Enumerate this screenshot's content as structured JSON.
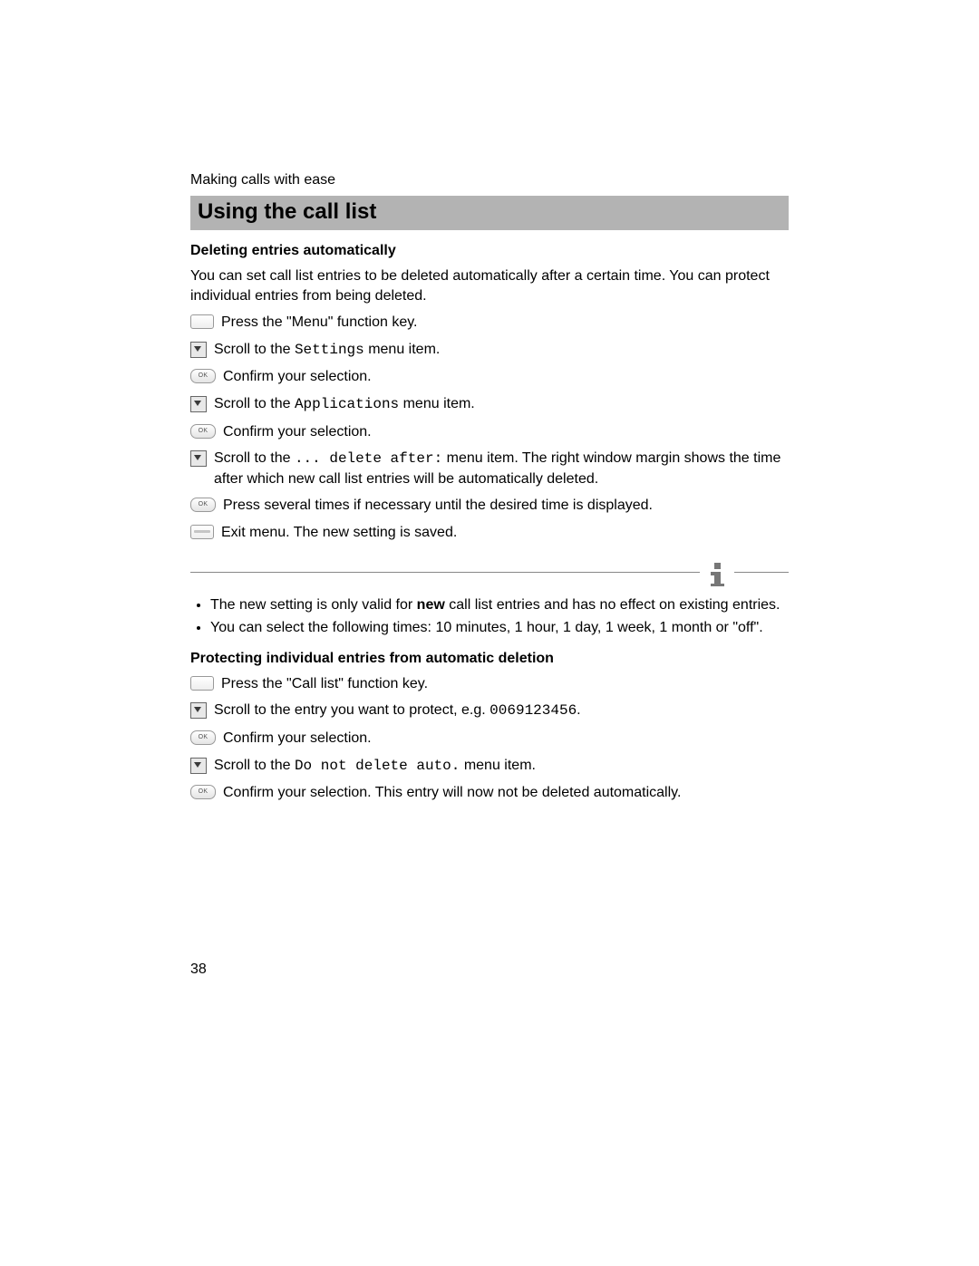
{
  "running_head": "Making calls with ease",
  "title": "Using the call list",
  "page_number": "38",
  "section1": {
    "heading": "Deleting entries automatically",
    "intro": "You can set call list entries to be deleted automatically after a certain time. You can protect individual entries from being deleted.",
    "step1": "Press the \"Menu\" function key.",
    "step2_pre": "Scroll to the ",
    "step2_code": "Settings",
    "step2_post": " menu item.",
    "step3": "Confirm your selection.",
    "step4_pre": "Scroll to the ",
    "step4_code": "Applications",
    "step4_post": " menu item.",
    "step5": "Confirm your selection.",
    "step6_pre": "Scroll to the ",
    "step6_code": "... delete after:",
    "step6_post": " menu item. The right window margin shows the time after which new call list entries will be automatically deleted.",
    "step7": "Press several times if necessary until the desired time is displayed.",
    "step8": "Exit menu. The new setting is saved."
  },
  "notes": {
    "n1_pre": "The new setting is only valid for ",
    "n1_bold": "new",
    "n1_post": " call list entries and has no effect on existing entries.",
    "n2": "You can select the following times: 10 minutes, 1 hour, 1 day, 1 week, 1 month or \"off\"."
  },
  "section2": {
    "heading": "Protecting individual entries from automatic deletion",
    "step1": "Press the \"Call list\" function key.",
    "step2_pre": "Scroll to the entry you want to protect, e.g. ",
    "step2_code": "0069123456",
    "step2_post": ".",
    "step3": "Confirm your selection.",
    "step4_pre": "Scroll to the ",
    "step4_code": "Do not delete auto.",
    "step4_post": " menu item.",
    "step5": "Confirm your selection. This entry will now not be deleted automatically."
  },
  "ok_label": "OK"
}
